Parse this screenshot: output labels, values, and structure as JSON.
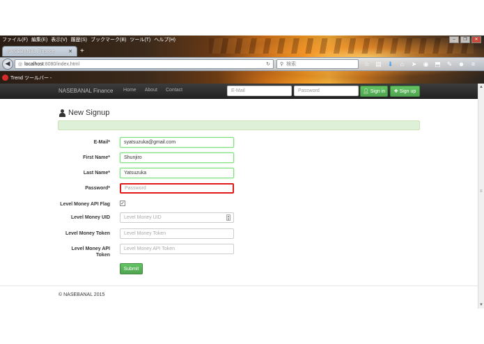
{
  "browser": {
    "menu": [
      "ファイル(F)",
      "編集(E)",
      "表示(V)",
      "履歴(S)",
      "ブックマーク(B)",
      "ツール(T)",
      "ヘルプ(H)"
    ],
    "tab_title": "NASEBANAL Finance",
    "url_host": "localhost",
    "url_path": ":8080/index.html",
    "search_placeholder": "検索",
    "trend_label": "Trend ツールバー -"
  },
  "site": {
    "brand": "NASEBANAL Finance",
    "nav": {
      "home": "Home",
      "about": "About",
      "contact": "Contact"
    },
    "login": {
      "email_placeholder": "E-Mail",
      "password_placeholder": "Password",
      "signin_label": "Sign in",
      "signup_label": "Sign up"
    }
  },
  "signup": {
    "heading": "New Signup",
    "email": {
      "label": "E-Mail*",
      "value": "syatsuzuka@gmail.com"
    },
    "first_name": {
      "label": "First Name*",
      "value": "Shunjiro"
    },
    "last_name": {
      "label": "Last Name*",
      "value": "Yatsuzuka"
    },
    "password": {
      "label": "Password*",
      "placeholder": "Password"
    },
    "api_flag": {
      "label": "Level Money API Flag",
      "checked": true
    },
    "uid": {
      "label": "Level Money UID",
      "placeholder": "Level Money UID"
    },
    "token": {
      "label": "Level Money Token",
      "placeholder": "Level Money Token"
    },
    "api_token": {
      "label_line1": "Level Money API",
      "label_line2": "Token",
      "placeholder": "Level Money API Token"
    },
    "submit_label": "Submit"
  },
  "footer": {
    "copyright": "© NASEBANAL 2015"
  },
  "colors": {
    "nav_bg": "#2b2b2b",
    "success_green": "#5bb75b",
    "alert_bg": "#dff0d8",
    "error_red": "#e21818",
    "valid_green": "#7ee07e"
  }
}
